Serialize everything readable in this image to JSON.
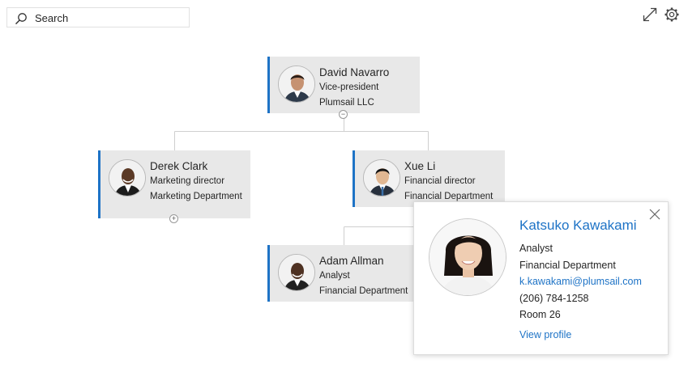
{
  "search": {
    "placeholder": "Search"
  },
  "toolbar": {
    "expand_icon": "expand-icon",
    "settings_icon": "gear-icon"
  },
  "people": {
    "david": {
      "name": "David Navarro",
      "title": "Vice-president",
      "department": "Plumsail LLC"
    },
    "derek": {
      "name": "Derek Clark",
      "title": "Marketing director",
      "department": "Marketing Department"
    },
    "xue": {
      "name": "Xue Li",
      "title": "Financial director",
      "department": "Financial Department"
    },
    "adam": {
      "name": "Adam Allman",
      "title": "Analyst",
      "department": "Financial Department"
    }
  },
  "toggles": {
    "collapse": "−",
    "expand": "+"
  },
  "popup": {
    "name": "Katsuko Kawakami",
    "title": "Analyst",
    "department": "Financial Department",
    "email": "k.kawakami@plumsail.com",
    "phone": "(206) 784-1258",
    "room": "Room 26",
    "view_profile": "View profile"
  },
  "colors": {
    "accent": "#1e73c6",
    "card_bg": "#e8e8e8",
    "connector": "#cfcfcf"
  }
}
